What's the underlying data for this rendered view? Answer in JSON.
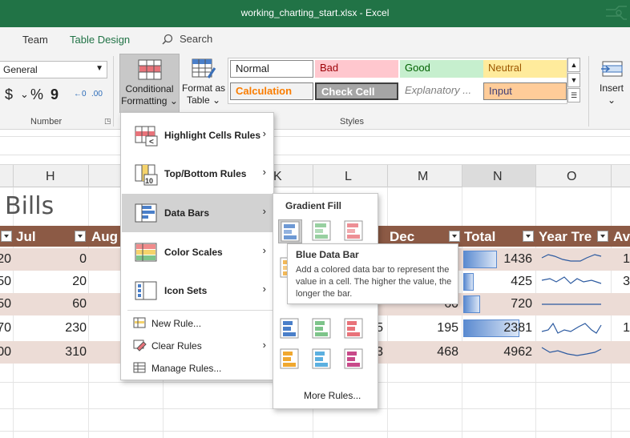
{
  "window": {
    "title": "working_charting_start.xlsx  -  Excel"
  },
  "menu": {
    "tabs": [
      "Team",
      "Table Design"
    ],
    "search_label": "Search"
  },
  "ribbon": {
    "number_format": "General",
    "number_buttons": [
      "$",
      "~",
      "%",
      "9",
      "←0",
      ".00"
    ],
    "number_group": "Number",
    "conditional_formatting": {
      "line1": "Conditional",
      "line2": "Formatting"
    },
    "format_as_table": {
      "line1": "Format as",
      "line2": "Table"
    },
    "insert": "Insert",
    "styles_group": "Styles",
    "styles": [
      {
        "label": "Normal",
        "bg": "#ffffff",
        "fg": "#222222"
      },
      {
        "label": "Bad",
        "bg": "#ffc7ce",
        "fg": "#9c0006"
      },
      {
        "label": "Good",
        "bg": "#c6efce",
        "fg": "#006100"
      },
      {
        "label": "Neutral",
        "bg": "#ffeb9c",
        "fg": "#9c5700"
      },
      {
        "label": "Calculation",
        "bg": "#f2f2f2",
        "fg": "#fa7d00"
      },
      {
        "label": "Check Cell",
        "bg": "#a5a5a5",
        "fg": "#ffffff"
      },
      {
        "label": "Explanatory ...",
        "bg": "#ffffff",
        "fg": "#7f7f7f"
      },
      {
        "label": "Input",
        "bg": "#ffcc99",
        "fg": "#3f3f76"
      }
    ]
  },
  "columns": [
    "H",
    "K",
    "L",
    "M",
    "N",
    "O"
  ],
  "sheet": {
    "title": "Bills",
    "headers": {
      "jul": "Jul",
      "aug": "Aug",
      "dec": "Dec",
      "total": "Total",
      "year_trend": "Year Tre",
      "avg": "Av"
    },
    "rows": [
      {
        "g": "20",
        "jul": "0",
        "l": "",
        "dec": "",
        "total": "1436",
        "p": "1",
        "bar": 0.6
      },
      {
        "g": "50",
        "jul": "20",
        "l": "",
        "dec": "",
        "total": "425",
        "p": "3",
        "bar": 0.18
      },
      {
        "g": "50",
        "jul": "60",
        "l": "",
        "dec": "60",
        "total": "720",
        "p": "",
        "bar": 0.3
      },
      {
        "g": "70",
        "jul": "230",
        "l": "5",
        "dec": "195",
        "total": "2381",
        "p": "1",
        "bar": 1.0
      },
      {
        "g": "00",
        "jul": "310",
        "l": "3",
        "dec": "468",
        "total": "4962",
        "p": "",
        "bar": 0
      }
    ]
  },
  "cf_menu": {
    "items": [
      "Highlight Cells Rules",
      "Top/Bottom Rules",
      "Data Bars",
      "Color Scales",
      "Icon Sets"
    ],
    "small_items": [
      "New Rule...",
      "Clear Rules",
      "Manage Rules..."
    ]
  },
  "databars_menu": {
    "heading": "Gradient Fill",
    "more_rules": "More Rules..."
  },
  "tooltip": {
    "title": "Blue Data Bar",
    "description": "Add a colored data bar to represent the value in a cell. The higher the value, the longer the bar."
  },
  "colors": {
    "excel_green": "#217346",
    "table_header": "#8c5a45",
    "row_shade": "#ecdcd6",
    "bar_blue": "#5a8ad0"
  }
}
